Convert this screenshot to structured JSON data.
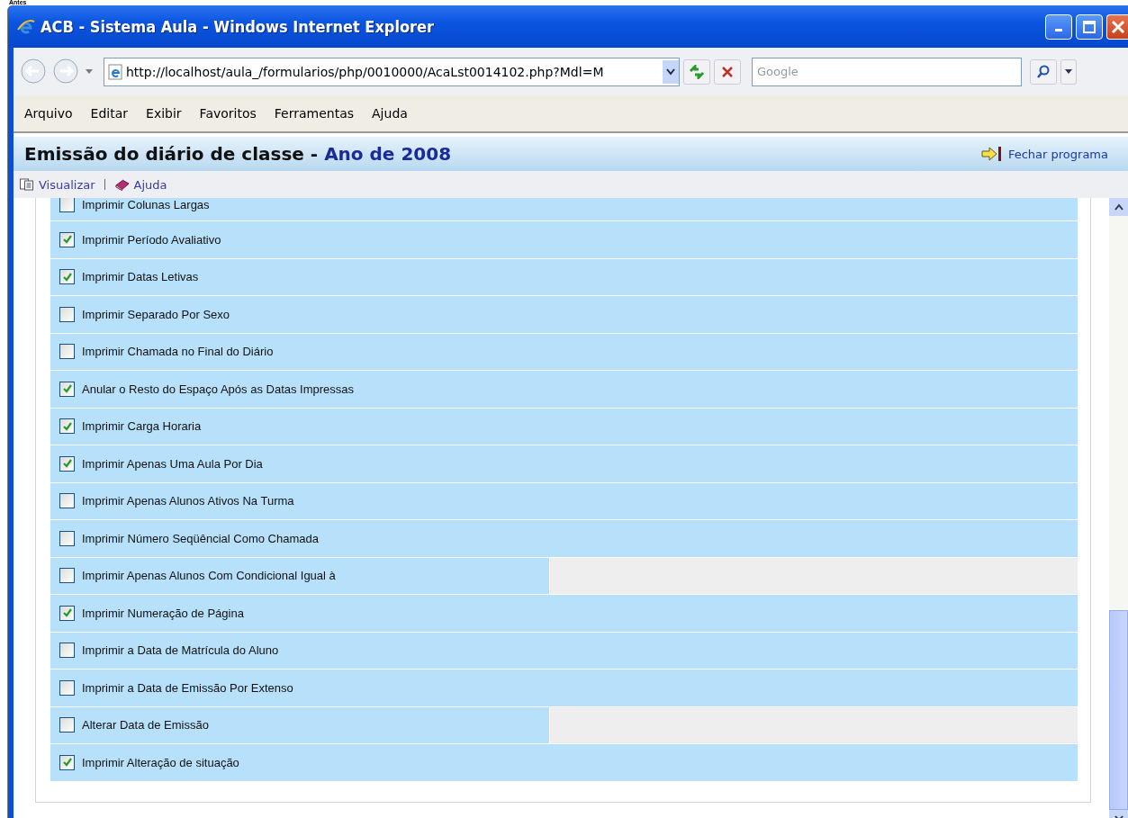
{
  "caption": "Antes",
  "window": {
    "title": "ACB - Sistema Aula - Windows Internet Explorer"
  },
  "address_bar": {
    "value": "http://localhost/aula_/formularios/php/0010000/AcaLst0014102.php?Mdl=M"
  },
  "search": {
    "placeholder": "Google"
  },
  "menu": [
    {
      "label": "Arquivo"
    },
    {
      "label": "Editar"
    },
    {
      "label": "Exibir"
    },
    {
      "label": "Favoritos"
    },
    {
      "label": "Ferramentas"
    },
    {
      "label": "Ajuda"
    }
  ],
  "page_header": {
    "title": "Emissão do diário de classe - ",
    "year": "Ano de 2008",
    "close_link": "Fechar programa"
  },
  "toolbar": [
    {
      "label": "Visualizar",
      "kind": "preview"
    },
    {
      "label": "Ajuda",
      "kind": "help"
    }
  ],
  "options": [
    {
      "label": "Imprimir Colunas Largas",
      "checked": false,
      "kind": "full"
    },
    {
      "label": "Imprimir Período Avaliativo",
      "checked": true,
      "kind": "full"
    },
    {
      "label": "Imprimir Datas Letivas",
      "checked": true,
      "kind": "full"
    },
    {
      "label": "Imprimir Separado Por Sexo",
      "checked": false,
      "kind": "full"
    },
    {
      "label": "Imprimir Chamada no Final do Diário",
      "checked": false,
      "kind": "full"
    },
    {
      "label": "Anular o Resto do Espaço Após as Datas Impressas",
      "checked": true,
      "kind": "full"
    },
    {
      "label": "Imprimir Carga Horaria",
      "checked": true,
      "kind": "full"
    },
    {
      "label": "Imprimir Apenas Uma Aula Por Dia",
      "checked": true,
      "kind": "full"
    },
    {
      "label": "Imprimir Apenas Alunos Ativos Na Turma",
      "checked": false,
      "kind": "full"
    },
    {
      "label": "Imprimir Número Seqüêncial Como Chamada",
      "checked": false,
      "kind": "full"
    },
    {
      "label": "Imprimir Apenas Alunos Com Condicional Igual à",
      "checked": false,
      "kind": "split"
    },
    {
      "label": "Imprimir Numeração de Página",
      "checked": true,
      "kind": "full"
    },
    {
      "label": "Imprimir a Data de Matrícula do Aluno",
      "checked": false,
      "kind": "full"
    },
    {
      "label": "Imprimir a Data de Emissão Por Extenso",
      "checked": false,
      "kind": "full"
    },
    {
      "label": "Alterar Data de Emissão",
      "checked": false,
      "kind": "split"
    },
    {
      "label": "Imprimir Alteração de situação",
      "checked": true,
      "kind": "full"
    }
  ]
}
